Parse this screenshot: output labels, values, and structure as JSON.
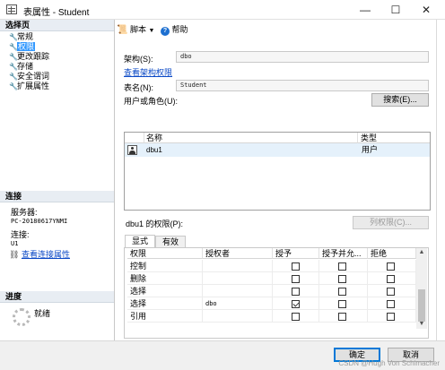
{
  "window": {
    "title": "表属性 - Student",
    "minimize": "—",
    "maximize": "☐",
    "close": "✕"
  },
  "sidebar": {
    "pages_header": "选择页",
    "pages": [
      {
        "label": "常规",
        "selected": false
      },
      {
        "label": "权限",
        "selected": true
      },
      {
        "label": "更改跟踪",
        "selected": false
      },
      {
        "label": "存储",
        "selected": false
      },
      {
        "label": "安全谓词",
        "selected": false
      },
      {
        "label": "扩展属性",
        "selected": false
      }
    ],
    "connection_header": "连接",
    "server_label": "服务器:",
    "server_value": "PC-20180617YNMI",
    "connection_label": "连接:",
    "connection_value": "U1",
    "view_connection_link": "查看连接属性",
    "progress_header": "进度",
    "progress_status": "就绪"
  },
  "toolbar": {
    "script_label": "脚本",
    "help_label": "帮助"
  },
  "form": {
    "schema_label": "架构(S):",
    "schema_value": "dbo",
    "view_schema_link": "查看架构权限",
    "table_label": "表名(N):",
    "table_value": "Student",
    "users_label": "用户或角色(U):",
    "search_button": "搜索(E)..."
  },
  "users_table": {
    "columns": [
      "名称",
      "类型"
    ],
    "rows": [
      {
        "name": "dbu1",
        "type": "用户"
      }
    ]
  },
  "permissions": {
    "title": "dbu1 的权限(P):",
    "column_permissions_button": "列权限(C)...",
    "tabs": [
      "显式",
      "有效"
    ],
    "columns": [
      "权限",
      "授权者",
      "授予",
      "授予并允...",
      "拒绝"
    ],
    "rows": [
      {
        "permission": "控制",
        "grantor": "",
        "grant": false,
        "with_grant": false,
        "deny": false
      },
      {
        "permission": "删除",
        "grantor": "",
        "grant": false,
        "with_grant": false,
        "deny": false
      },
      {
        "permission": "选择",
        "grantor": "",
        "grant": false,
        "with_grant": false,
        "deny": false
      },
      {
        "permission": "选择",
        "grantor": "dbo",
        "grant": true,
        "with_grant": false,
        "deny": false
      },
      {
        "permission": "引用",
        "grantor": "",
        "grant": false,
        "with_grant": false,
        "deny": false
      }
    ]
  },
  "buttons": {
    "ok": "确定",
    "cancel": "取消"
  },
  "watermark": "CSDN @Hugh Von Schimacher"
}
